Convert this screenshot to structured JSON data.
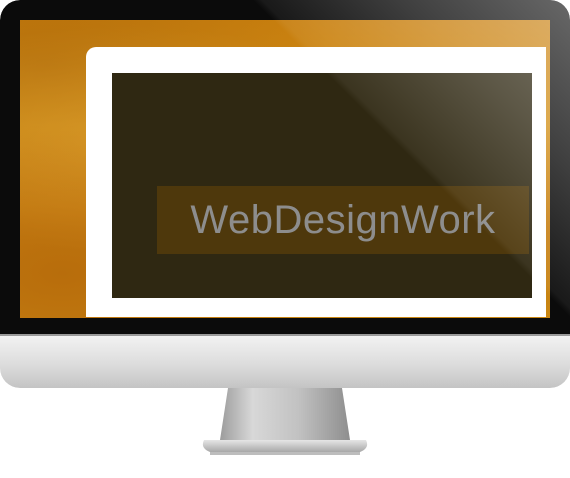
{
  "site": {
    "title": "WebDesignWork"
  },
  "colors": {
    "screen_background": "#c9800f",
    "content_panel": "#2f2812",
    "title_band": "#4e380c",
    "title_text": "#8d8d8d",
    "bezel": "#0b0b0b",
    "frame": "#ffffff"
  },
  "icons": {
    "device": "desktop-monitor-icon"
  }
}
